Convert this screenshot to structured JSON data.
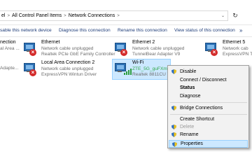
{
  "address": {
    "segments": [
      "el",
      "All Control Panel Items",
      "Network Connections"
    ],
    "dropdown": "⌄",
    "refresh": "↻"
  },
  "toolbar": {
    "disable": "sable this network device",
    "diagnose": "Diagnose this connection",
    "rename": "Rename this connection",
    "view_status": "View status of this connection",
    "more": "»"
  },
  "connections": [
    {
      "name": "nection",
      "status": "",
      "adapter": "al Area ..."
    },
    {
      "name": "Ethernet",
      "status": "Network cable unplugged",
      "adapter": "Realtek PCIe GbE Family Controller"
    },
    {
      "name": "Ethernet 2",
      "status": "Network cable unplugged",
      "adapter": "TunnelBear Adapter V9"
    },
    {
      "name": "Ethernet 5",
      "status": "Network cab",
      "adapter": "ExpressVPN TA"
    },
    {
      "name": "",
      "status": "",
      "adapter": "Adapte..."
    },
    {
      "name": "Local Area Connection 2",
      "status": "Network cable unplugged",
      "adapter": "ExpressVPN Wintun Driver"
    },
    {
      "name": "Wi-Fi",
      "status": "ZTE_5G_guFXmX",
      "adapter": "Realtek 8811CU W"
    }
  ],
  "context_menu": {
    "items": [
      {
        "label": "Disable",
        "shield": true
      },
      {
        "label": "Connect / Disconnect"
      },
      {
        "label": "Status"
      },
      {
        "label": "Diagnose"
      },
      {
        "label": "Bridge Connections",
        "shield": true
      },
      {
        "label": "Create Shortcut"
      },
      {
        "label": "Delete",
        "shield": true
      },
      {
        "label": "Rename",
        "shield": true
      },
      {
        "label": "Properties",
        "shield": true
      }
    ]
  },
  "colors": {
    "link_blue": "#1e3c78",
    "selection": "#cce8ff",
    "error_red": "#d32a2a",
    "wifi_green": "#2e9d3f"
  }
}
